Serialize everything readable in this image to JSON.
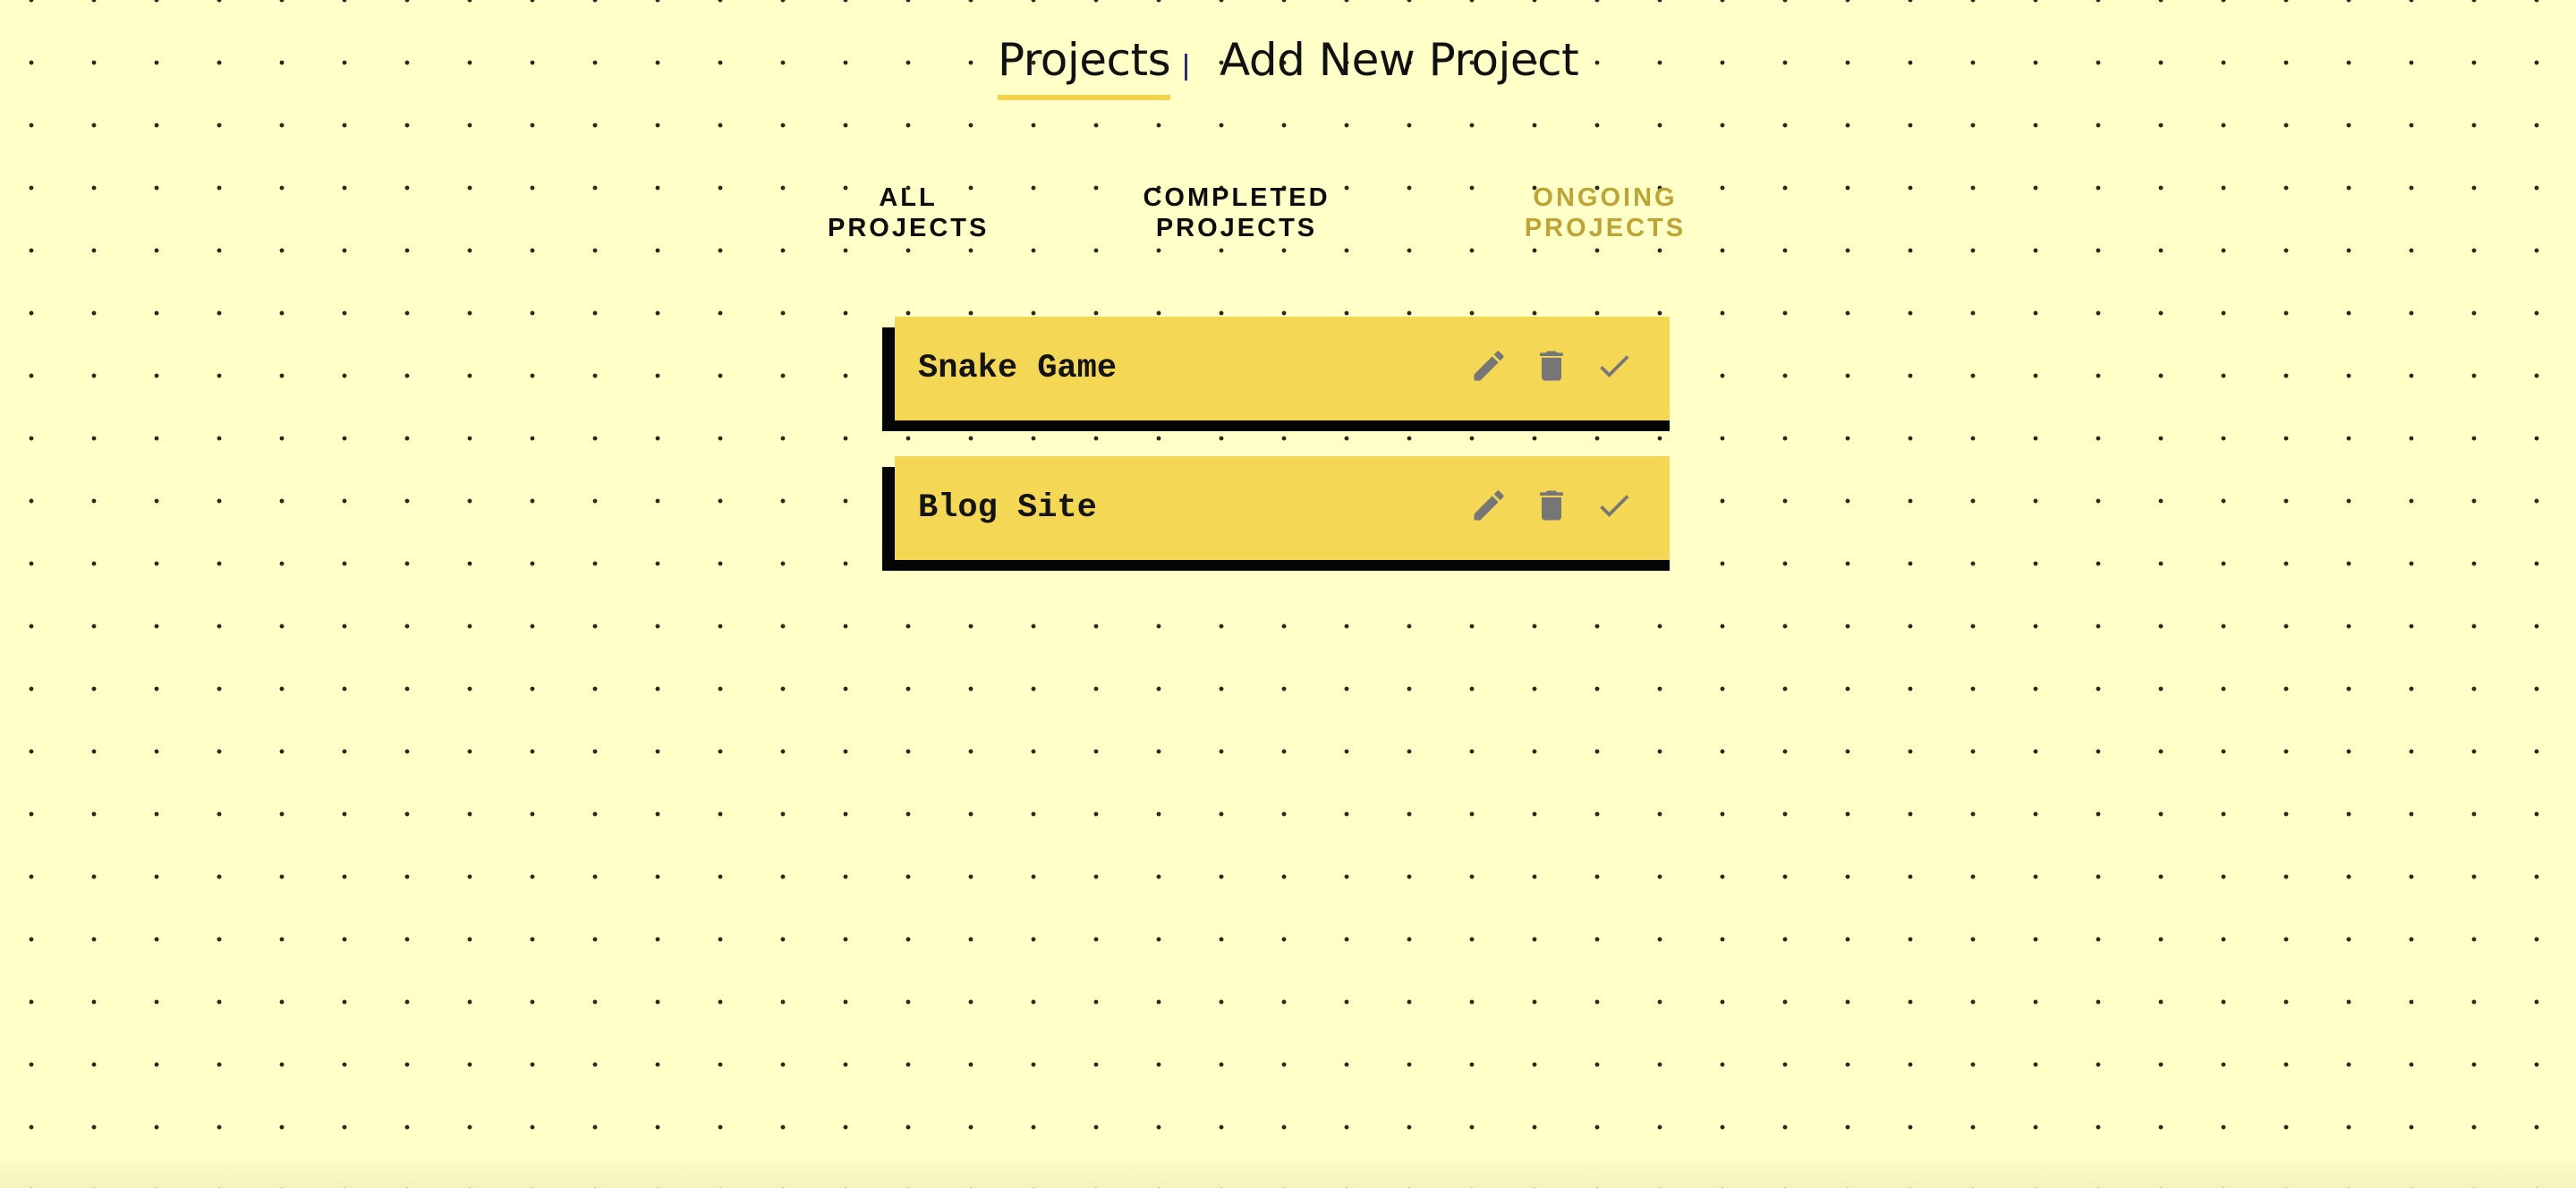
{
  "nav": {
    "projects_label": "Projects",
    "add_label": "Add New Project"
  },
  "filters": {
    "all": {
      "line1": "ALL",
      "line2": "PROJECTS"
    },
    "completed": {
      "line1": "COMPLETED",
      "line2": "PROJECTS"
    },
    "ongoing": {
      "line1": "ONGOING",
      "line2": "PROJECTS",
      "active": true
    }
  },
  "projects": [
    {
      "title": "Snake Game",
      "icons": [
        "pencil-icon",
        "trash-icon",
        "check-icon"
      ]
    },
    {
      "title": "Blog Site",
      "icons": [
        "pencil-icon",
        "trash-icon",
        "check-icon"
      ]
    }
  ],
  "colors": {
    "background": "#ffffc8",
    "card": "#f4d755",
    "underline": "#f2d24d",
    "active_filter": "#bca536",
    "icon": "#767676"
  }
}
